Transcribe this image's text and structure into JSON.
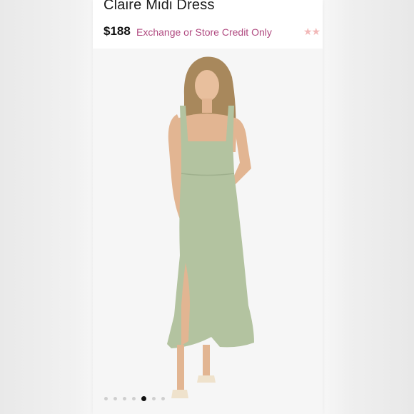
{
  "product": {
    "title": "Claire Midi Dress",
    "price": "$188",
    "policy": "Exchange or Store Credit Only",
    "rating_stars": "★★"
  },
  "colors": {
    "policy": "#b04a80",
    "dress": "#b3c3a0",
    "background": "#ededed"
  },
  "gallery": {
    "dot_count": 7,
    "active_index": 4
  }
}
